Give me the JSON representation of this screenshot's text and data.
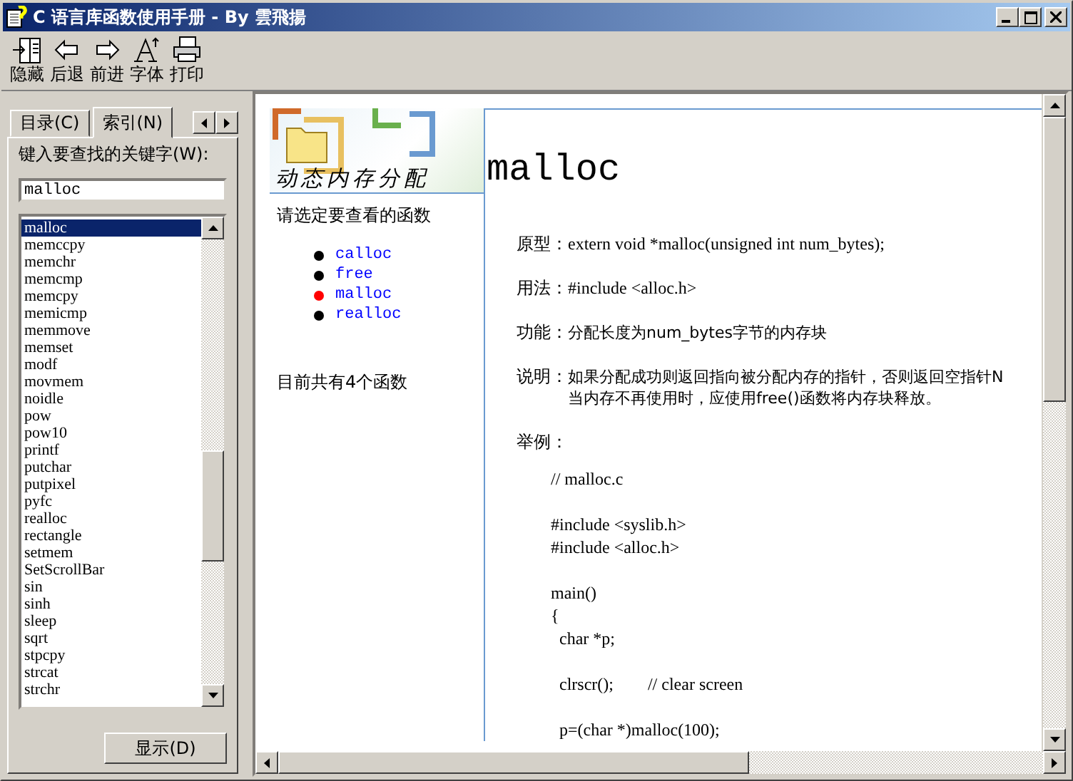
{
  "window": {
    "title": "C 语言库函数使用手册 - By 雲飛揚"
  },
  "toolbar": [
    {
      "label": "隐藏",
      "kind": "hide"
    },
    {
      "label": "后退",
      "kind": "back"
    },
    {
      "label": "前进",
      "kind": "forward"
    },
    {
      "label": "字体",
      "kind": "font"
    },
    {
      "label": "打印",
      "kind": "print"
    }
  ],
  "tabs": [
    {
      "label": "目录(C)",
      "selected": false
    },
    {
      "label": "索引(N)",
      "selected": true
    }
  ],
  "search": {
    "label": "键入要查找的关键字(W):",
    "value": "malloc"
  },
  "index_list": [
    {
      "label": "malloc",
      "selected": true
    },
    {
      "label": "memccpy",
      "selected": false
    },
    {
      "label": "memchr",
      "selected": false
    },
    {
      "label": "memcmp",
      "selected": false
    },
    {
      "label": "memcpy",
      "selected": false
    },
    {
      "label": "memicmp",
      "selected": false
    },
    {
      "label": "memmove",
      "selected": false
    },
    {
      "label": "memset",
      "selected": false
    },
    {
      "label": "modf",
      "selected": false
    },
    {
      "label": "movmem",
      "selected": false
    },
    {
      "label": "noidle",
      "selected": false
    },
    {
      "label": "pow",
      "selected": false
    },
    {
      "label": "pow10",
      "selected": false
    },
    {
      "label": "printf",
      "selected": false
    },
    {
      "label": "putchar",
      "selected": false
    },
    {
      "label": "putpixel",
      "selected": false
    },
    {
      "label": "pyfc",
      "selected": false
    },
    {
      "label": "realloc",
      "selected": false
    },
    {
      "label": "rectangle",
      "selected": false
    },
    {
      "label": "setmem",
      "selected": false
    },
    {
      "label": "SetScrollBar",
      "selected": false
    },
    {
      "label": "sin",
      "selected": false
    },
    {
      "label": "sinh",
      "selected": false
    },
    {
      "label": "sleep",
      "selected": false
    },
    {
      "label": "sqrt",
      "selected": false
    },
    {
      "label": "stpcpy",
      "selected": false
    },
    {
      "label": "strcat",
      "selected": false
    },
    {
      "label": "strchr",
      "selected": false
    }
  ],
  "display_button": "显示(D)",
  "page": {
    "banner_caption": "动态内存分配",
    "prompt": "请选定要查看的函数",
    "functions": [
      {
        "label": "calloc",
        "current": false
      },
      {
        "label": "free",
        "current": false
      },
      {
        "label": "malloc",
        "current": true
      },
      {
        "label": "realloc",
        "current": false
      }
    ],
    "count_note": "目前共有4个函数",
    "heading": "malloc",
    "fields": [
      {
        "label": "原型：",
        "lines": [
          "extern void *malloc(unsigned int num_bytes);"
        ]
      },
      {
        "label": "用法：",
        "lines": [
          "#include <alloc.h>"
        ]
      },
      {
        "label": "功能：",
        "lines": [
          "分配长度为num_bytes字节的内存块"
        ]
      },
      {
        "label": "说明：",
        "lines": [
          "如果分配成功则返回指向被分配内存的指针，否则返回空指针N",
          "当内存不再使用时，应使用free()函数将内存块释放。"
        ]
      }
    ],
    "example_label": "举例：",
    "code": [
      {
        "lines": [
          "// malloc.c"
        ]
      },
      {
        "lines": [
          "#include <syslib.h>",
          "#include <alloc.h>"
        ]
      },
      {
        "lines": [
          "main()",
          "{",
          "  char *p;"
        ]
      },
      {
        "lines": [
          "  clrscr();        // clear screen"
        ]
      },
      {
        "lines": [
          "  p=(char *)malloc(100);"
        ]
      }
    ]
  }
}
